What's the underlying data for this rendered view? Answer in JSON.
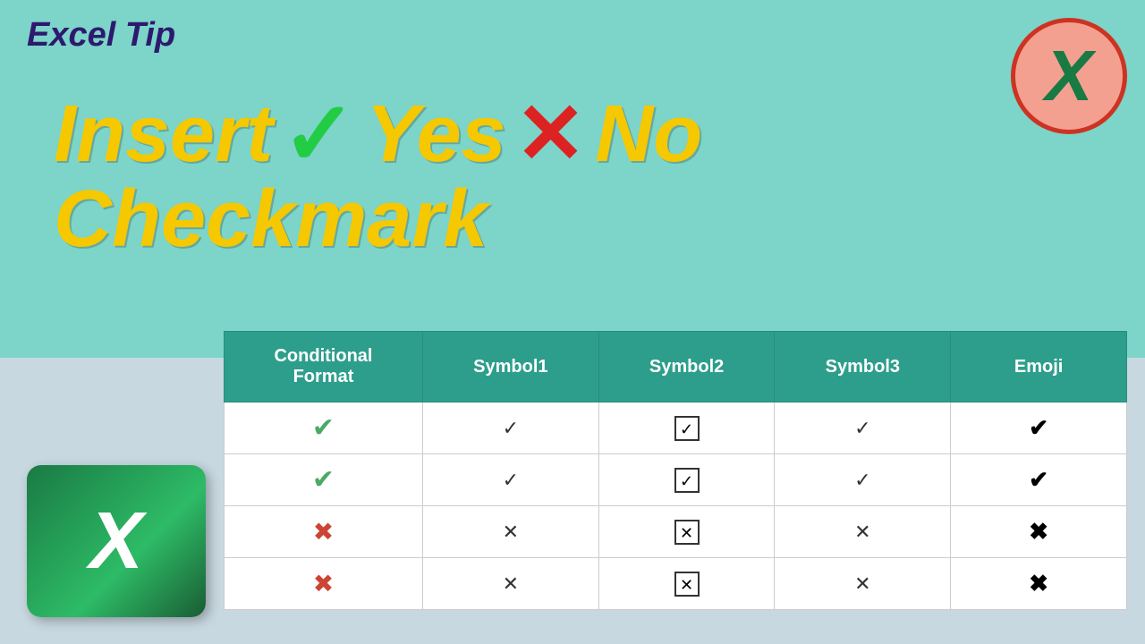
{
  "title": "Excel Tip",
  "heading": {
    "line1": {
      "insert": "Insert",
      "check_symbol": "✓",
      "yes": "Yes",
      "x_symbol": "✕",
      "no": "No"
    },
    "line2": "Checkmark"
  },
  "logo_top": {
    "letter": "X"
  },
  "logo_bottom": {
    "letter": "X"
  },
  "table": {
    "headers": [
      "Conditional Format",
      "Symbol1",
      "Symbol2",
      "Symbol3",
      "Emoji"
    ],
    "rows": [
      {
        "conditional": "✔ green",
        "symbol1": "✓",
        "symbol2": "☑",
        "symbol3": "✓",
        "emoji": "✔"
      },
      {
        "conditional": "✔ green",
        "symbol1": "✓",
        "symbol2": "☑",
        "symbol3": "✓",
        "emoji": "✔"
      },
      {
        "conditional": "✘ red",
        "symbol1": "✗",
        "symbol2": "☒",
        "symbol3": "✗",
        "emoji": "✘"
      },
      {
        "conditional": "✘ red",
        "symbol1": "✗",
        "symbol2": "☒",
        "symbol3": "✗",
        "emoji": "✘"
      }
    ]
  }
}
